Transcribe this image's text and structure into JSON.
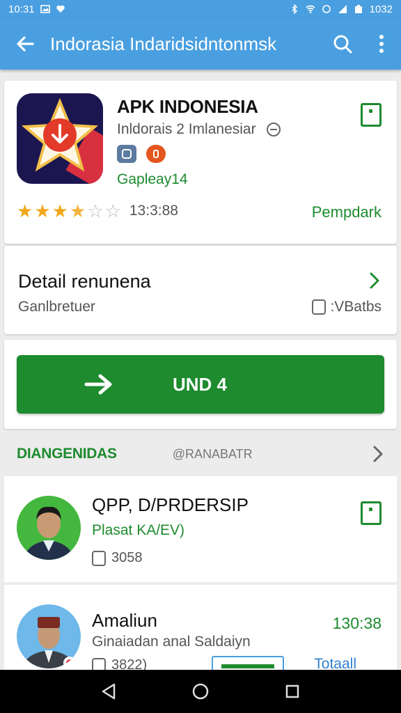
{
  "status_bar": {
    "time": "10:31",
    "battery": "1032"
  },
  "app_bar": {
    "title": "Indorasia Indaridsidntonmsk"
  },
  "app": {
    "name": "APK INDONESIA",
    "subtitle": "Inldorais 2 Imlanesiar",
    "developer": "Gapleay14",
    "rating_count": "13:3:88",
    "rating_stars": 3.5,
    "install_label": "Pempdark"
  },
  "detail": {
    "title": "Detail renunena",
    "subtitle": "Ganlbretuer",
    "meta": ":VBatbs"
  },
  "primary_action": {
    "label": "UND 4"
  },
  "section": {
    "title": "DIANGENIDAS",
    "subtitle": "@RANABATR"
  },
  "items": [
    {
      "title": "QPP, D/PRDERSIP",
      "subtitle": "Plasat KA/EV)",
      "meta": "3058"
    },
    {
      "title": "Amaliun",
      "subtitle": "Ginaiadan anal Saldaiyn",
      "meta": "3822)",
      "right": "130:38",
      "link": "Totaall"
    }
  ],
  "colors": {
    "accent": "#4a9fe0",
    "green": "#1d8b2e",
    "star": "#f2a81d"
  }
}
